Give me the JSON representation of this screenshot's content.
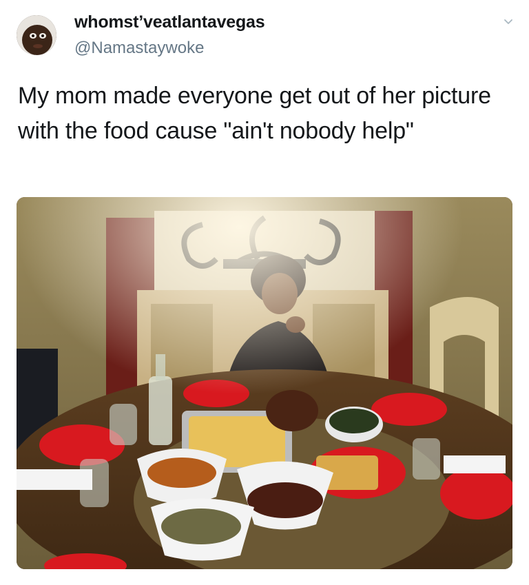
{
  "tweet": {
    "display_name": "whomst’veatlantavegas",
    "handle": "@Namastaywoke",
    "text": "My mom made everyone get out of her picture with the food cause \"ain't nobody help\""
  },
  "icons": {
    "caret": "chevron-down-icon",
    "avatar": "user-avatar"
  },
  "colors": {
    "name": "#14171a",
    "handle": "#657786",
    "plate_red": "#d8191f"
  }
}
